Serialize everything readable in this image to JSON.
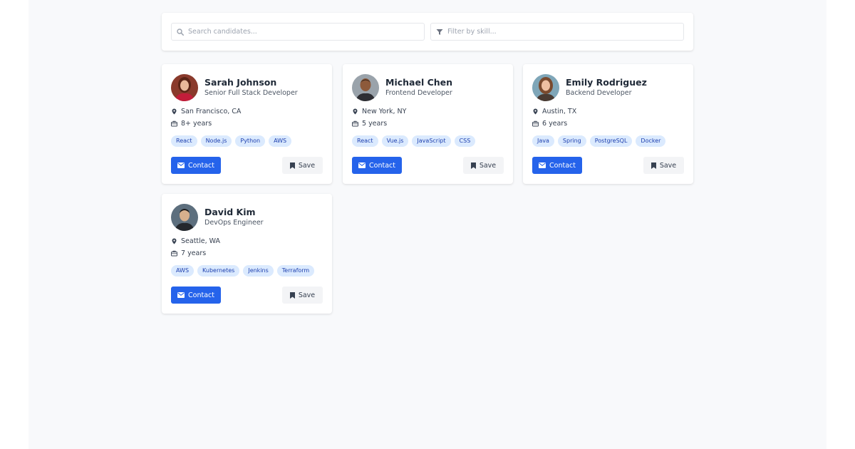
{
  "search": {
    "placeholder": "Search candidates..."
  },
  "filter": {
    "placeholder": "Filter by skill..."
  },
  "candidates": [
    {
      "name": "Sarah Johnson",
      "role": "Senior Full Stack Developer",
      "location": "San Francisco, CA",
      "experience": "8+ years",
      "skills": [
        "React",
        "Node.js",
        "Python",
        "AWS"
      ],
      "contact_label": "Contact",
      "save_label": "Save"
    },
    {
      "name": "Michael Chen",
      "role": "Frontend Developer",
      "location": "New York, NY",
      "experience": "5 years",
      "skills": [
        "React",
        "Vue.js",
        "JavaScript",
        "CSS"
      ],
      "contact_label": "Contact",
      "save_label": "Save"
    },
    {
      "name": "Emily Rodriguez",
      "role": "Backend Developer",
      "location": "Austin, TX",
      "experience": "6 years",
      "skills": [
        "Java",
        "Spring",
        "PostgreSQL",
        "Docker"
      ],
      "contact_label": "Contact",
      "save_label": "Save"
    },
    {
      "name": "David Kim",
      "role": "DevOps Engineer",
      "location": "Seattle, WA",
      "experience": "7 years",
      "skills": [
        "AWS",
        "Kubernetes",
        "Jenkins",
        "Terraform"
      ],
      "contact_label": "Contact",
      "save_label": "Save"
    }
  ],
  "colors": {
    "primary": "#2563eb",
    "tag_bg": "#dbeafe",
    "tag_text": "#1e40af",
    "page_bg": "#f8f9fb"
  }
}
